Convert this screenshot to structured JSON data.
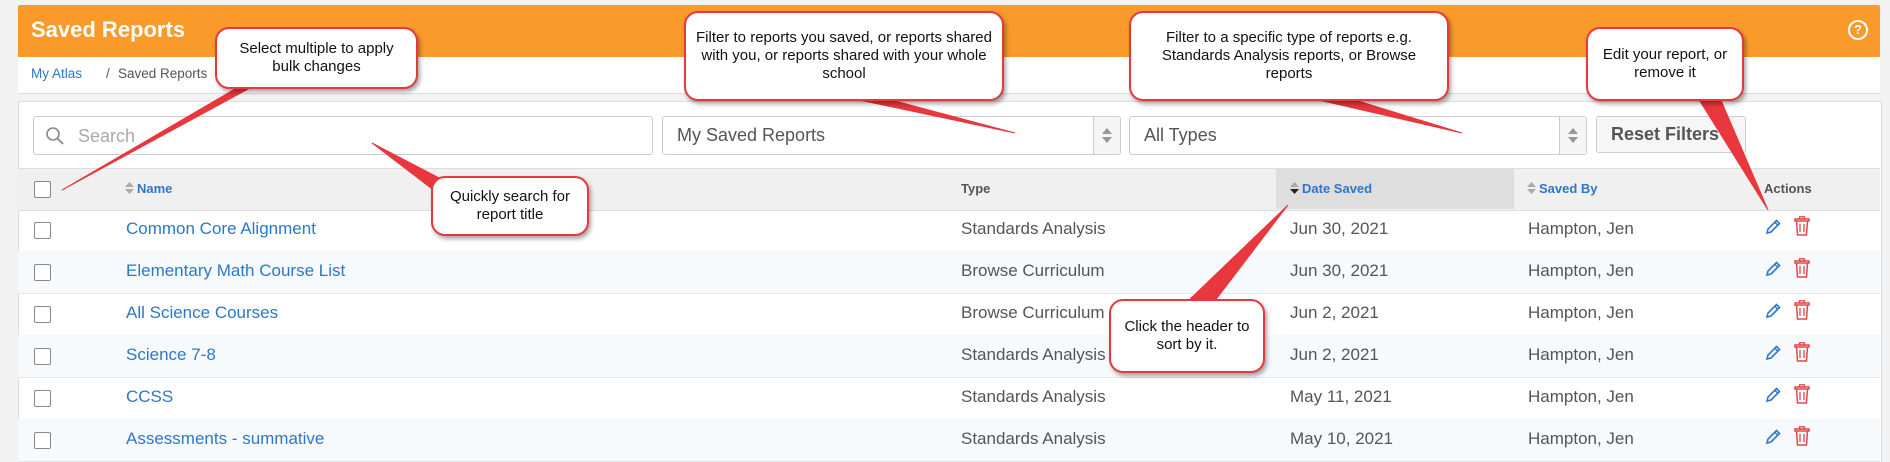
{
  "header": {
    "title": "Saved Reports",
    "help_icon": "question-circle-icon",
    "help_glyph": "?"
  },
  "breadcrumb": {
    "home": "My Atlas",
    "separator": "/",
    "current": "Saved Reports"
  },
  "filters": {
    "search_placeholder": "Search",
    "owner_select": "My Saved Reports",
    "type_select": "All Types",
    "reset_label": "Reset Filters"
  },
  "table": {
    "columns": {
      "name": "Name",
      "type": "Type",
      "date_saved": "Date Saved",
      "saved_by": "Saved By",
      "actions": "Actions"
    },
    "sorted_column": "Date Saved",
    "rows": [
      {
        "name": "Common Core Alignment",
        "type": "Standards Analysis",
        "date": "Jun 30, 2021",
        "by": "Hampton, Jen"
      },
      {
        "name": "Elementary Math Course List",
        "type": "Browse Curriculum",
        "date": "Jun 30, 2021",
        "by": "Hampton, Jen"
      },
      {
        "name": "All Science Courses",
        "type": "Browse Curriculum",
        "date": "Jun 2, 2021",
        "by": "Hampton, Jen"
      },
      {
        "name": "Science 7-8",
        "type": "Standards Analysis",
        "date": "Jun 2, 2021",
        "by": "Hampton, Jen"
      },
      {
        "name": "CCSS",
        "type": "Standards Analysis",
        "date": "May 11, 2021",
        "by": "Hampton, Jen"
      },
      {
        "name": "Assessments - summative",
        "type": "Standards Analysis",
        "date": "May 10, 2021",
        "by": "Hampton, Jen"
      }
    ]
  },
  "callouts": {
    "select_multiple": "Select multiple to apply bulk changes",
    "filter_owner": "Filter to reports you saved, or reports shared with you, or reports shared with your whole school",
    "filter_type": "Filter to a specific type of reports e.g. Standards Analysis reports, or Browse reports",
    "edit_report": "Edit your report, or remove it",
    "search_title": "Quickly search for report title",
    "sort_header": "Click the header to sort by it."
  },
  "colors": {
    "header": "#f99a2b",
    "link": "#2c77c9",
    "callout_border": "#e8373d",
    "delete": "#e04848"
  }
}
